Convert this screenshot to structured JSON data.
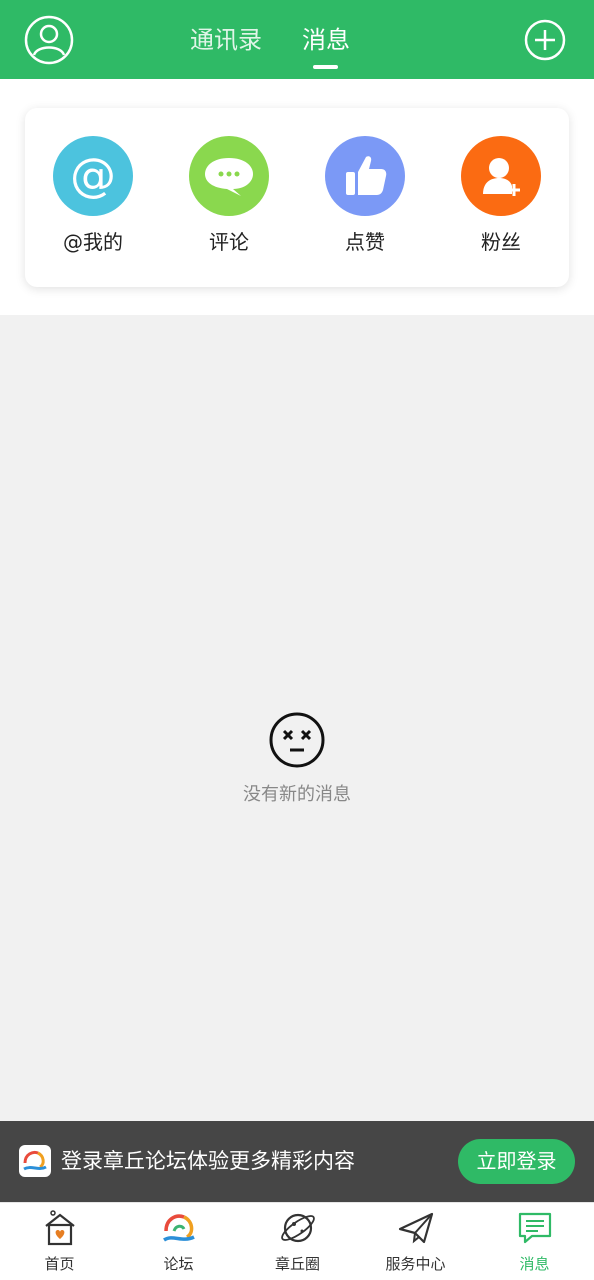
{
  "header": {
    "tabs": [
      {
        "label": "通讯录",
        "active": false
      },
      {
        "label": "消息",
        "active": true
      }
    ],
    "accent_color": "#2fba66"
  },
  "shortcuts": [
    {
      "label": "@我的",
      "icon": "at-icon",
      "color": "#4cc3de"
    },
    {
      "label": "评论",
      "icon": "comment-icon",
      "color": "#8ad84e"
    },
    {
      "label": "点赞",
      "icon": "thumbs-up-icon",
      "color": "#7b99f6"
    },
    {
      "label": "粉丝",
      "icon": "add-follower-icon",
      "color": "#fb6b12"
    }
  ],
  "empty_state": {
    "text": "没有新的消息",
    "icon": "dizzy-face-icon"
  },
  "login_banner": {
    "text": "登录章丘论坛体验更多精彩内容",
    "button_label": "立即登录"
  },
  "bottom_nav": [
    {
      "label": "首页",
      "icon": "home-icon",
      "active": false
    },
    {
      "label": "论坛",
      "icon": "forum-logo-icon",
      "active": false
    },
    {
      "label": "章丘圈",
      "icon": "planet-icon",
      "active": false
    },
    {
      "label": "服务中心",
      "icon": "paper-plane-icon",
      "active": false
    },
    {
      "label": "消息",
      "icon": "message-icon",
      "active": true
    }
  ]
}
